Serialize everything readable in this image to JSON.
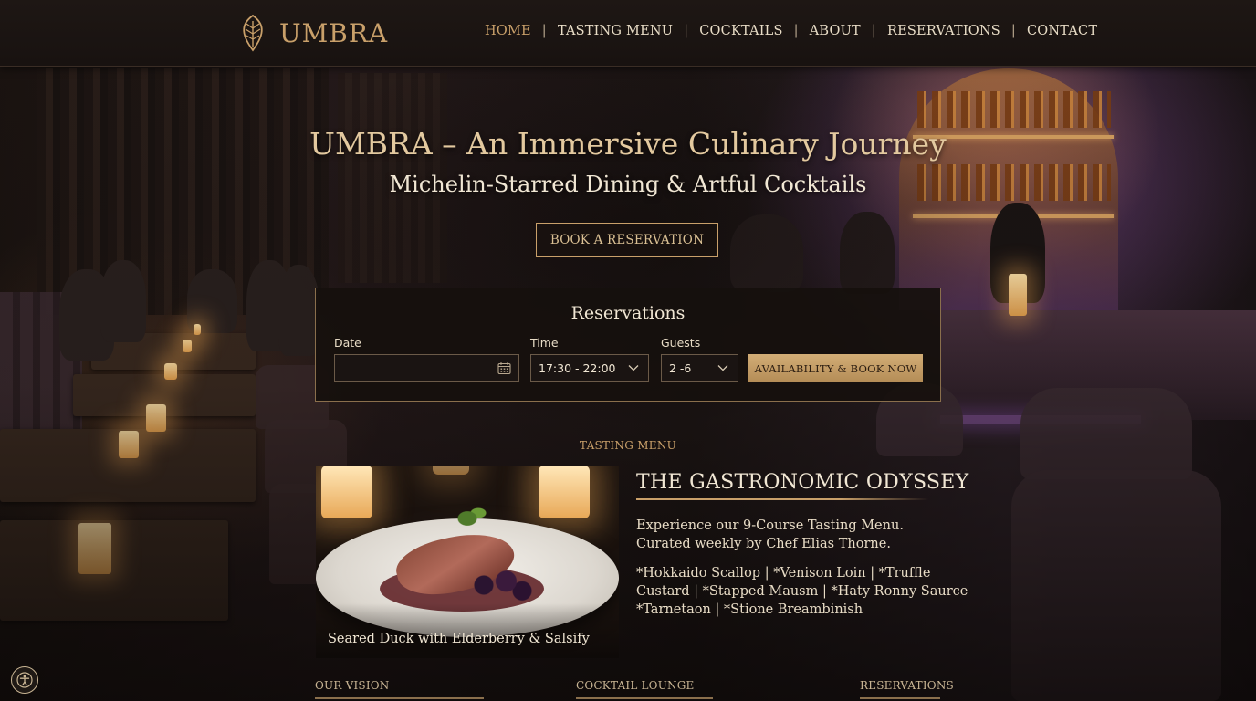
{
  "brand": {
    "name": "UMBRA",
    "accent": "#c9a06a"
  },
  "nav": {
    "items": [
      "HOME",
      "TASTING MENU",
      "COCKTAILS",
      "ABOUT",
      "RESERVATIONS",
      "CONTACT"
    ],
    "active": "HOME"
  },
  "hero": {
    "title": "UMBRA – An Immersive Culinary Journey",
    "subtitle": "Michelin-Starred Dining & Artful Cocktails",
    "cta": "BOOK A RESERVATION"
  },
  "reservations": {
    "title": "Reservations",
    "date_label": "Date",
    "date_value": "",
    "time_label": "Time",
    "time_value": "17:30 - 22:00",
    "guests_label": "Guests",
    "guests_value": "2 -6",
    "button": "AVAILABILITY & BOOK NOW"
  },
  "tasting": {
    "kicker": "TASTING MENU",
    "dish_caption": "Seared Duck with Elderberry & Salsify",
    "title": "THE GASTRONOMIC ODYSSEY",
    "intro_line1": "Experience our 9-Course Tasting Menu.",
    "intro_line2": "Curated weekly by Chef Elias Thorne.",
    "courses_line1": "*Hokkaido Scallop | *Venison Loin | *Truffle",
    "courses_line2": "Custard | *Stapped Mausm | *Haty Ronny Saurce",
    "courses_line3": "*Tarnetaon | *Stione Breambinish"
  },
  "footer": {
    "vision": "OUR VISION",
    "cocktail": "COCKTAIL LOUNGE",
    "reservations": "RESERVATIONS"
  },
  "icons": {
    "logo": "leaf-emblem-icon",
    "calendar": "calendar-icon",
    "chevron": "chevron-down-icon",
    "accessibility": "accessibility-icon"
  }
}
